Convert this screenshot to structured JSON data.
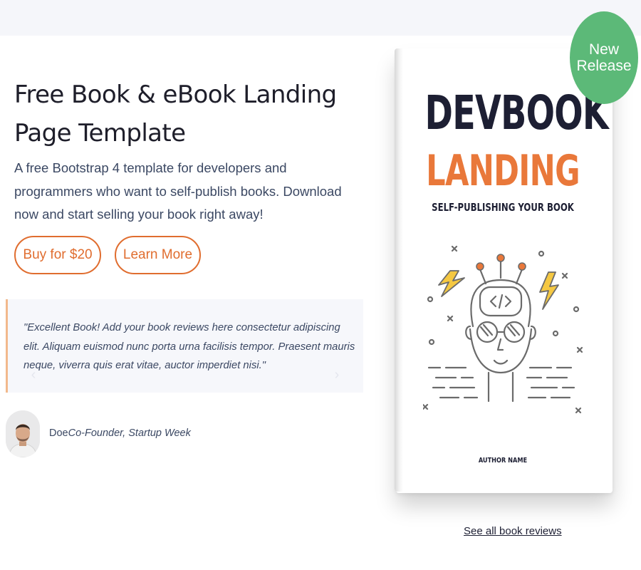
{
  "hero": {
    "title": "Free Book & eBook Landing Page Template",
    "description": "A free Bootstrap 4 template for developers and programmers who want to self-publish books. Download now and start selling your book right away!",
    "buy_label": "Buy for $20",
    "learn_label": "Learn More"
  },
  "testimonial": {
    "quote": "\"Excellent Book! Add your book reviews here consectetur adipiscing elit. Aliquam euismod nunc porta urna facilisis tempor. Praesent mauris neque, viverra quis erat vitae, auctor imperdiet nisi.\"",
    "name": "Doe",
    "role": "Co-Founder, Startup Week",
    "prev_icon": "chevron-left-icon",
    "next_icon": "chevron-right-icon"
  },
  "book": {
    "title_line1": "DEVBOOK",
    "title_line2": "LANDING",
    "subtitle": "SELF-PUBLISHING YOUR BOOK",
    "author": "AUTHOR NAME"
  },
  "badge": {
    "label": "New Release"
  },
  "links": {
    "see_all_reviews": "See all book reviews"
  },
  "colors": {
    "accent": "#e06d2f",
    "badge": "#5cb978",
    "text": "#3b4863",
    "book_title": "#1d1f33",
    "book_orange": "#e9783a"
  }
}
